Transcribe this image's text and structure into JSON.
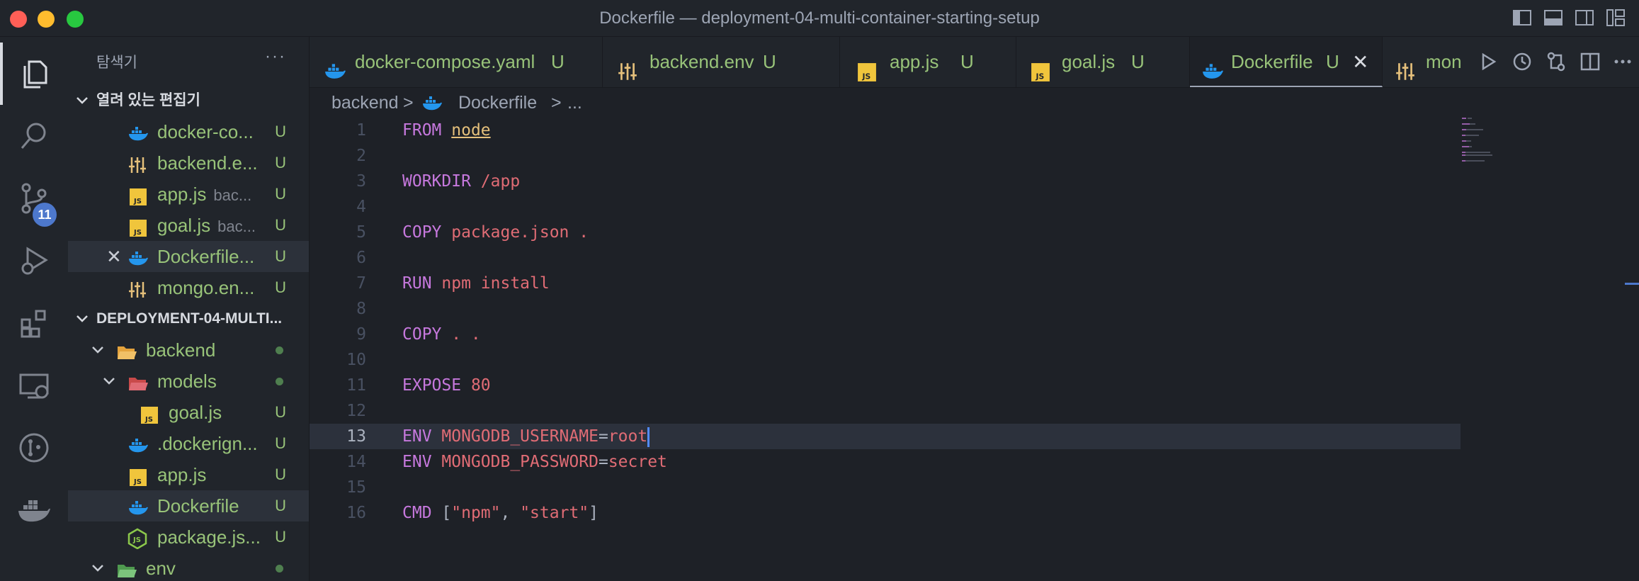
{
  "window": {
    "title": "Dockerfile — deployment-04-multi-container-starting-setup"
  },
  "activity_bar": {
    "source_control_badge": "11"
  },
  "sidebar": {
    "title": "탐색기",
    "more": "···",
    "open_editors": {
      "label": "열려 있는 편집기",
      "items": [
        {
          "name": "docker-co...",
          "desc": "",
          "status": "U",
          "icon": "docker-icon"
        },
        {
          "name": "backend.e...",
          "desc": "",
          "status": "U",
          "icon": "env-icon"
        },
        {
          "name": "app.js",
          "desc": "bac...",
          "status": "U",
          "icon": "js-icon"
        },
        {
          "name": "goal.js",
          "desc": "bac...",
          "status": "U",
          "icon": "js-icon"
        },
        {
          "name": "Dockerfile...",
          "desc": "",
          "status": "U",
          "icon": "docker-icon",
          "close": "✕"
        },
        {
          "name": "mongo.en...",
          "desc": "",
          "status": "U",
          "icon": "env-icon"
        }
      ]
    },
    "project": {
      "label": "DEPLOYMENT-04-MULTI...",
      "tree": [
        {
          "name": "backend",
          "icon": "folder-open-icon"
        },
        {
          "name": "models",
          "icon": "folder-open-icon"
        },
        {
          "name": "goal.js",
          "status": "U",
          "icon": "js-icon"
        },
        {
          "name": ".dockerign...",
          "status": "U",
          "icon": "docker-icon"
        },
        {
          "name": "app.js",
          "status": "U",
          "icon": "js-icon"
        },
        {
          "name": "Dockerfile",
          "status": "U",
          "icon": "docker-icon"
        },
        {
          "name": "package.js...",
          "status": "U",
          "icon": "nodejs-icon"
        },
        {
          "name": "env",
          "icon": "folder-open-icon"
        }
      ]
    }
  },
  "tabs": [
    {
      "label": "docker-compose.yaml",
      "status": "U",
      "icon": "docker-icon"
    },
    {
      "label": "backend.env",
      "status": "U",
      "icon": "env-icon"
    },
    {
      "label": "app.js",
      "status": "U",
      "icon": "js-icon"
    },
    {
      "label": "goal.js",
      "status": "U",
      "icon": "js-icon"
    },
    {
      "label": "Dockerfile",
      "status": "U",
      "icon": "docker-icon",
      "close": "✕"
    },
    {
      "label": "mong",
      "status": "",
      "icon": "env-icon"
    }
  ],
  "breadcrumb": {
    "folder": "backend",
    "sep": ">",
    "file": "Dockerfile",
    "more": "..."
  },
  "editor": {
    "current_line": 13,
    "lines": [
      {
        "n": "1",
        "parts": [
          {
            "t": "FROM",
            "c": "kw"
          },
          {
            "t": " ",
            "c": "punc"
          },
          {
            "t": "node",
            "c": "hl"
          }
        ]
      },
      {
        "n": "2",
        "parts": []
      },
      {
        "n": "3",
        "parts": [
          {
            "t": "WORKDIR",
            "c": "kw"
          },
          {
            "t": " /app",
            "c": "str"
          }
        ]
      },
      {
        "n": "4",
        "parts": []
      },
      {
        "n": "5",
        "parts": [
          {
            "t": "COPY",
            "c": "kw"
          },
          {
            "t": " package.json .",
            "c": "str"
          }
        ]
      },
      {
        "n": "6",
        "parts": []
      },
      {
        "n": "7",
        "parts": [
          {
            "t": "RUN",
            "c": "kw"
          },
          {
            "t": " npm install",
            "c": "str"
          }
        ]
      },
      {
        "n": "8",
        "parts": []
      },
      {
        "n": "9",
        "parts": [
          {
            "t": "COPY",
            "c": "kw"
          },
          {
            "t": " . .",
            "c": "str"
          }
        ]
      },
      {
        "n": "10",
        "parts": []
      },
      {
        "n": "11",
        "parts": [
          {
            "t": "EXPOSE",
            "c": "kw"
          },
          {
            "t": " 80",
            "c": "str"
          }
        ]
      },
      {
        "n": "12",
        "parts": []
      },
      {
        "n": "13",
        "parts": [
          {
            "t": "ENV",
            "c": "kw"
          },
          {
            "t": " MONGODB_USERNAME",
            "c": "str"
          },
          {
            "t": "=",
            "c": "punc"
          },
          {
            "t": "root",
            "c": "str"
          }
        ]
      },
      {
        "n": "14",
        "parts": [
          {
            "t": "ENV",
            "c": "kw"
          },
          {
            "t": " MONGODB_PASSWORD",
            "c": "str"
          },
          {
            "t": "=",
            "c": "punc"
          },
          {
            "t": "secret",
            "c": "str"
          }
        ]
      },
      {
        "n": "15",
        "parts": []
      },
      {
        "n": "16",
        "parts": [
          {
            "t": "CMD",
            "c": "kw"
          },
          {
            "t": " [",
            "c": "punc"
          },
          {
            "t": "\"npm\"",
            "c": "str"
          },
          {
            "t": ", ",
            "c": "punc"
          },
          {
            "t": "\"start\"",
            "c": "str"
          },
          {
            "t": "]",
            "c": "punc"
          }
        ]
      }
    ]
  },
  "colors": {
    "keyword": "#c678dd",
    "string": "#e06c75",
    "untracked": "#98c379",
    "accent": "#4d78cc"
  }
}
